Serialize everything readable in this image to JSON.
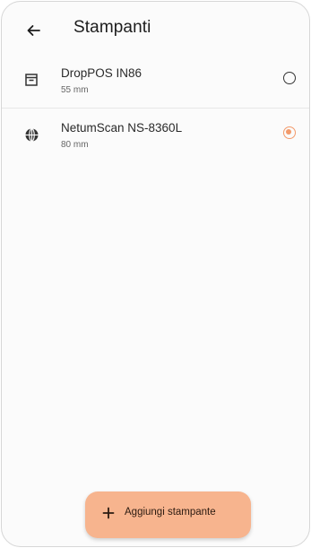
{
  "header": {
    "title": "Stampanti",
    "back_icon": "arrow-back-icon"
  },
  "printers": [
    {
      "name": "DropPOS IN86",
      "paper_width": "55 mm",
      "icon": "receipt-printer-icon",
      "selected": false
    },
    {
      "name": "NetumScan NS-8360L",
      "paper_width": "80 mm",
      "icon": "globe-network-icon",
      "selected": true
    }
  ],
  "fab": {
    "label": "Aggiungi stampante",
    "icon": "plus-icon"
  },
  "colors": {
    "accent": "#f29a6b",
    "fab_background": "#f7b48e"
  }
}
